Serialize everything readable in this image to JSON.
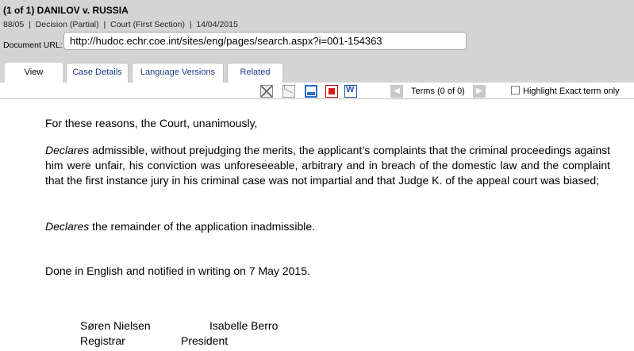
{
  "header": {
    "title": "(1 of 1) DANILOV v. RUSSIA",
    "meta": "88/05  |  Decision (Partial)  |  Court (First Section)  |  14/04/2015",
    "url_label": "Document URL:",
    "url_value": "http://hudoc.echr.coe.int/sites/eng/pages/search.aspx?i=001-154363"
  },
  "tabs": [
    {
      "label": "View",
      "active": true
    },
    {
      "label": "Case Details"
    },
    {
      "label": "Language Versions"
    },
    {
      "label": "Related"
    }
  ],
  "toolbar": {
    "icons": [
      "collapse-icon",
      "email-icon",
      "print-icon",
      "pdf-icon",
      "word-icon"
    ],
    "prev": "◀",
    "next": "▶",
    "terms": "Terms (0 of 0)",
    "highlight_label": "Highlight Exact term only"
  },
  "document": {
    "p1": "For these reasons, the Court, unanimously,",
    "p2_em": "Declares",
    "p2_text": " admissible, without prejudging the merits, the applicant’s complaints that the criminal proceedings against him were unfair, his conviction was unforeseeable, arbitrary and in breach of the domestic law and the complaint that the first instance jury in his criminal case was not impartial and that Judge K. of the appeal court was biased;",
    "p3_em": "Declares",
    "p3_text": " the remainder of the application inadmissible.",
    "p4": "Done in English and notified in writing on 7 May 2015.",
    "signatures": {
      "registrar_name": "Søren Nielsen",
      "registrar_title": "Registrar",
      "president_name": "Isabelle Berro",
      "president_title": "President"
    }
  }
}
